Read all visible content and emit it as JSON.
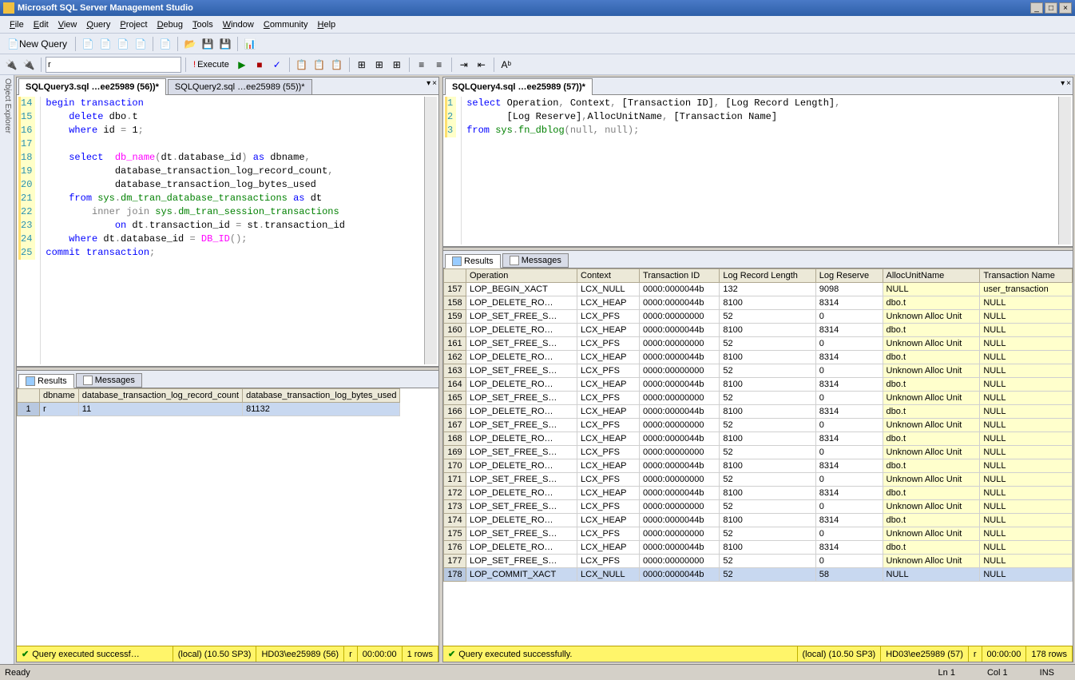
{
  "title": "Microsoft SQL Server Management Studio",
  "menu": [
    "File",
    "Edit",
    "View",
    "Query",
    "Project",
    "Debug",
    "Tools",
    "Window",
    "Community",
    "Help"
  ],
  "toolbar1": {
    "new_query": "New Query"
  },
  "toolbar2": {
    "db_combo": "r",
    "execute": "Execute"
  },
  "obj_explorer": "Object Explorer",
  "left": {
    "tabs": [
      "SQLQuery3.sql …ee25989 (56))*",
      "SQLQuery2.sql …ee25989 (55))*"
    ],
    "active_tab": 0,
    "code_lines": [
      {
        "n": 14,
        "html": "<span class='kw-blue'>begin</span> <span class='kw-blue'>transaction</span>"
      },
      {
        "n": 15,
        "html": "    <span class='kw-blue'>delete</span> dbo<span class='kw-gray'>.</span>t"
      },
      {
        "n": 16,
        "html": "    <span class='kw-blue'>where</span> id <span class='kw-gray'>=</span> 1<span class='kw-gray'>;</span>"
      },
      {
        "n": 17,
        "html": ""
      },
      {
        "n": 18,
        "html": "    <span class='kw-blue'>select</span>  <span class='kw-magenta'>db_name</span><span class='kw-gray'>(</span>dt<span class='kw-gray'>.</span>database_id<span class='kw-gray'>)</span> <span class='kw-blue'>as</span> dbname<span class='kw-gray'>,</span>"
      },
      {
        "n": 19,
        "html": "            database_transaction_log_record_count<span class='kw-gray'>,</span>"
      },
      {
        "n": 20,
        "html": "            database_transaction_log_bytes_used"
      },
      {
        "n": 21,
        "html": "    <span class='kw-blue'>from</span> <span class='kw-green'>sys</span><span class='kw-gray'>.</span><span class='kw-green'>dm_tran_database_transactions</span> <span class='kw-blue'>as</span> dt"
      },
      {
        "n": 22,
        "html": "        <span class='kw-gray'>inner</span> <span class='kw-gray'>join</span> <span class='kw-green'>sys</span><span class='kw-gray'>.</span><span class='kw-green'>dm_tran_session_transactions</span>"
      },
      {
        "n": 23,
        "html": "            <span class='kw-blue'>on</span> dt<span class='kw-gray'>.</span>transaction_id <span class='kw-gray'>=</span> st<span class='kw-gray'>.</span>transaction_id"
      },
      {
        "n": 24,
        "html": "    <span class='kw-blue'>where</span> dt<span class='kw-gray'>.</span>database_id <span class='kw-gray'>=</span> <span class='kw-magenta'>DB_ID</span><span class='kw-gray'>();</span>"
      },
      {
        "n": 25,
        "html": "<span class='kw-blue'>commit</span> <span class='kw-blue'>transaction</span><span class='kw-gray'>;</span>"
      }
    ],
    "results_tabs": [
      "Results",
      "Messages"
    ],
    "grid_headers": [
      "dbname",
      "database_transaction_log_record_count",
      "database_transaction_log_bytes_used"
    ],
    "grid_rows": [
      {
        "n": 1,
        "cells": [
          "r",
          "11",
          "81132"
        ],
        "sel": true
      }
    ],
    "status": {
      "msg": "Query executed successf…",
      "server": "(local) (10.50 SP3)",
      "user": "HD03\\ee25989 (56)",
      "db": "r",
      "time": "00:00:00",
      "rows": "1 rows"
    }
  },
  "right": {
    "tabs": [
      "SQLQuery4.sql …ee25989 (57))*"
    ],
    "code_lines": [
      {
        "n": 1,
        "html": "<span class='kw-blue'>select</span> Operation<span class='kw-gray'>,</span> Context<span class='kw-gray'>,</span> [Transaction ID]<span class='kw-gray'>,</span> [Log Record Length]<span class='kw-gray'>,</span>"
      },
      {
        "n": 2,
        "html": "       [Log Reserve]<span class='kw-gray'>,</span>AllocUnitName<span class='kw-gray'>,</span> [Transaction Name]"
      },
      {
        "n": 3,
        "html": "<span class='kw-blue'>from</span> <span class='kw-green'>sys</span><span class='kw-gray'>.</span><span class='kw-green'>fn_dblog</span><span class='kw-gray'>(</span><span class='kw-gray'>null</span><span class='kw-gray'>,</span> <span class='kw-gray'>null</span><span class='kw-gray'>);</span>"
      }
    ],
    "results_tabs": [
      "Results",
      "Messages"
    ],
    "grid_headers": [
      "Operation",
      "Context",
      "Transaction ID",
      "Log Record Length",
      "Log Reserve",
      "AllocUnitName",
      "Transaction Name"
    ],
    "grid_rows": [
      {
        "n": 157,
        "cells": [
          "LOP_BEGIN_XACT",
          "LCX_NULL",
          "0000:0000044b",
          "132",
          "9098",
          "NULL",
          "user_transaction"
        ]
      },
      {
        "n": 158,
        "cells": [
          "LOP_DELETE_RO…",
          "LCX_HEAP",
          "0000:0000044b",
          "8100",
          "8314",
          "dbo.t",
          "NULL"
        ]
      },
      {
        "n": 159,
        "cells": [
          "LOP_SET_FREE_S…",
          "LCX_PFS",
          "0000:00000000",
          "52",
          "0",
          "Unknown Alloc Unit",
          "NULL"
        ]
      },
      {
        "n": 160,
        "cells": [
          "LOP_DELETE_RO…",
          "LCX_HEAP",
          "0000:0000044b",
          "8100",
          "8314",
          "dbo.t",
          "NULL"
        ]
      },
      {
        "n": 161,
        "cells": [
          "LOP_SET_FREE_S…",
          "LCX_PFS",
          "0000:00000000",
          "52",
          "0",
          "Unknown Alloc Unit",
          "NULL"
        ]
      },
      {
        "n": 162,
        "cells": [
          "LOP_DELETE_RO…",
          "LCX_HEAP",
          "0000:0000044b",
          "8100",
          "8314",
          "dbo.t",
          "NULL"
        ]
      },
      {
        "n": 163,
        "cells": [
          "LOP_SET_FREE_S…",
          "LCX_PFS",
          "0000:00000000",
          "52",
          "0",
          "Unknown Alloc Unit",
          "NULL"
        ]
      },
      {
        "n": 164,
        "cells": [
          "LOP_DELETE_RO…",
          "LCX_HEAP",
          "0000:0000044b",
          "8100",
          "8314",
          "dbo.t",
          "NULL"
        ]
      },
      {
        "n": 165,
        "cells": [
          "LOP_SET_FREE_S…",
          "LCX_PFS",
          "0000:00000000",
          "52",
          "0",
          "Unknown Alloc Unit",
          "NULL"
        ]
      },
      {
        "n": 166,
        "cells": [
          "LOP_DELETE_RO…",
          "LCX_HEAP",
          "0000:0000044b",
          "8100",
          "8314",
          "dbo.t",
          "NULL"
        ]
      },
      {
        "n": 167,
        "cells": [
          "LOP_SET_FREE_S…",
          "LCX_PFS",
          "0000:00000000",
          "52",
          "0",
          "Unknown Alloc Unit",
          "NULL"
        ]
      },
      {
        "n": 168,
        "cells": [
          "LOP_DELETE_RO…",
          "LCX_HEAP",
          "0000:0000044b",
          "8100",
          "8314",
          "dbo.t",
          "NULL"
        ]
      },
      {
        "n": 169,
        "cells": [
          "LOP_SET_FREE_S…",
          "LCX_PFS",
          "0000:00000000",
          "52",
          "0",
          "Unknown Alloc Unit",
          "NULL"
        ]
      },
      {
        "n": 170,
        "cells": [
          "LOP_DELETE_RO…",
          "LCX_HEAP",
          "0000:0000044b",
          "8100",
          "8314",
          "dbo.t",
          "NULL"
        ]
      },
      {
        "n": 171,
        "cells": [
          "LOP_SET_FREE_S…",
          "LCX_PFS",
          "0000:00000000",
          "52",
          "0",
          "Unknown Alloc Unit",
          "NULL"
        ]
      },
      {
        "n": 172,
        "cells": [
          "LOP_DELETE_RO…",
          "LCX_HEAP",
          "0000:0000044b",
          "8100",
          "8314",
          "dbo.t",
          "NULL"
        ]
      },
      {
        "n": 173,
        "cells": [
          "LOP_SET_FREE_S…",
          "LCX_PFS",
          "0000:00000000",
          "52",
          "0",
          "Unknown Alloc Unit",
          "NULL"
        ]
      },
      {
        "n": 174,
        "cells": [
          "LOP_DELETE_RO…",
          "LCX_HEAP",
          "0000:0000044b",
          "8100",
          "8314",
          "dbo.t",
          "NULL"
        ]
      },
      {
        "n": 175,
        "cells": [
          "LOP_SET_FREE_S…",
          "LCX_PFS",
          "0000:00000000",
          "52",
          "0",
          "Unknown Alloc Unit",
          "NULL"
        ]
      },
      {
        "n": 176,
        "cells": [
          "LOP_DELETE_RO…",
          "LCX_HEAP",
          "0000:0000044b",
          "8100",
          "8314",
          "dbo.t",
          "NULL"
        ]
      },
      {
        "n": 177,
        "cells": [
          "LOP_SET_FREE_S…",
          "LCX_PFS",
          "0000:00000000",
          "52",
          "0",
          "Unknown Alloc Unit",
          "NULL"
        ]
      },
      {
        "n": 178,
        "cells": [
          "LOP_COMMIT_XACT",
          "LCX_NULL",
          "0000:0000044b",
          "52",
          "58",
          "NULL",
          "NULL"
        ],
        "sel": true
      }
    ],
    "status": {
      "msg": "Query executed successfully.",
      "server": "(local) (10.50 SP3)",
      "user": "HD03\\ee25989 (57)",
      "db": "r",
      "time": "00:00:00",
      "rows": "178 rows"
    }
  },
  "bottom_status": {
    "ready": "Ready",
    "ln": "Ln 1",
    "col": "Col 1",
    "ins": "INS"
  }
}
